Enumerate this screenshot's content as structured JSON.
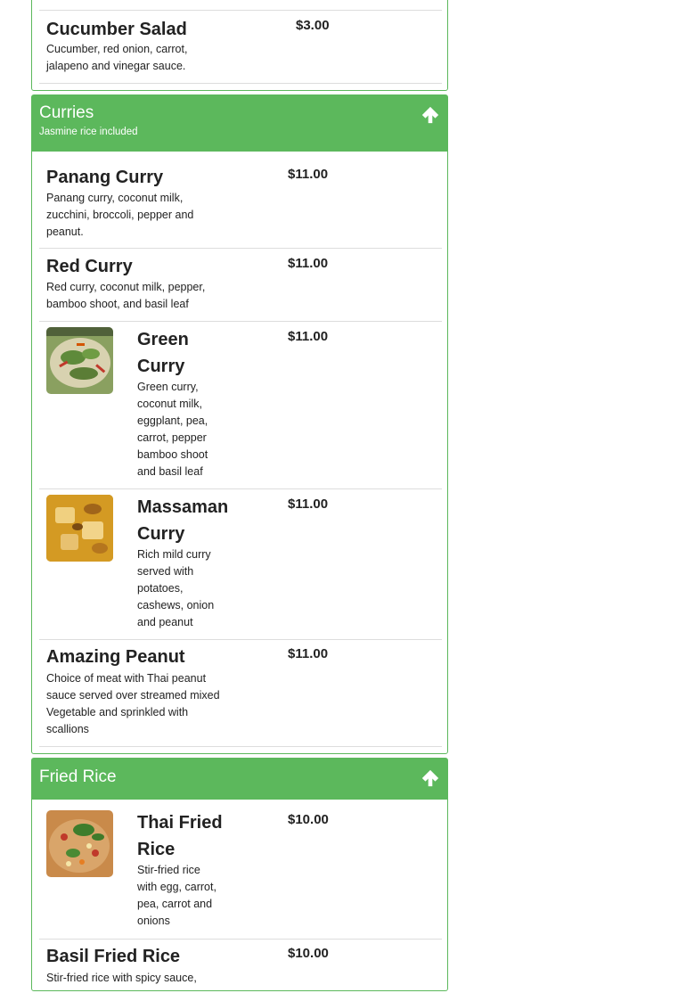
{
  "salads": {
    "items": [
      {
        "name": "Cucumber Salad",
        "description": "Cucumber, red onion, carrot, jalapeno and vinegar sauce.",
        "price": "$3.00"
      }
    ]
  },
  "curries": {
    "title": "Curries",
    "subtitle": "Jasmine rice included",
    "items": [
      {
        "name": "Panang Curry",
        "description": "Panang curry, coconut milk, zucchini, broccoli, pepper and peanut.",
        "price": "$11.00"
      },
      {
        "name": "Red Curry",
        "description": "Red curry, coconut milk, pepper, bamboo shoot, and basil leaf",
        "price": "$11.00"
      },
      {
        "name": "Green Curry",
        "description": "Green curry, coconut milk, eggplant, pea, carrot, pepper bamboo shoot and basil leaf",
        "price": "$11.00"
      },
      {
        "name": "Massaman Curry",
        "description": "Rich mild curry served with potatoes, cashews, onion and peanut",
        "price": "$11.00"
      },
      {
        "name": "Amazing Peanut",
        "description": "Choice of meat with Thai peanut sauce served over streamed mixed Vegetable and sprinkled with scallions",
        "price": "$11.00"
      }
    ]
  },
  "fried_rice": {
    "title": "Fried Rice",
    "items": [
      {
        "name": "Thai Fried Rice",
        "description": "Stir-fried rice with egg, carrot, pea, carrot and onions",
        "price": "$10.00"
      },
      {
        "name": "Basil Fried Rice",
        "description": "Stir-fried rice with spicy sauce,",
        "price": "$10.00"
      }
    ]
  },
  "icons": {
    "collapse": "arrow-up-icon"
  },
  "colors": {
    "accent": "#5cb85c",
    "divider": "#dddddd"
  }
}
